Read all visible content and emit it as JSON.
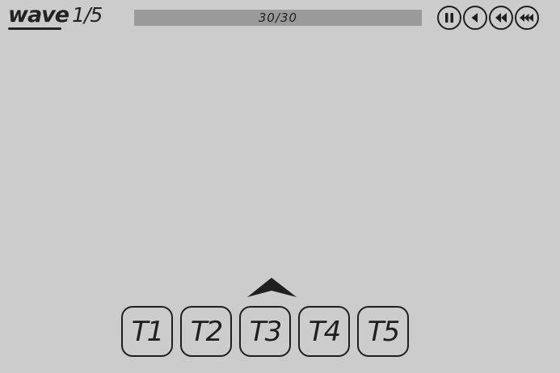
{
  "wave": {
    "label": "wave",
    "count": "1/5"
  },
  "health": {
    "text": "30/30",
    "current": 30,
    "max": 30,
    "fill_color": "#9a9a9a",
    "track_color": "#e0e0e0"
  },
  "controls": [
    {
      "name": "pause-icon",
      "action": "pause"
    },
    {
      "name": "play-icon",
      "action": "play"
    },
    {
      "name": "fast-forward-icon",
      "action": "fast"
    },
    {
      "name": "fastest-forward-icon",
      "action": "fastest"
    }
  ],
  "towers": {
    "selected_index": 2,
    "items": [
      {
        "label": "T1"
      },
      {
        "label": "T2"
      },
      {
        "label": "T3"
      },
      {
        "label": "T4"
      },
      {
        "label": "T5"
      }
    ]
  },
  "colors": {
    "background": "#cccccc",
    "ink": "#1f1f1f"
  }
}
